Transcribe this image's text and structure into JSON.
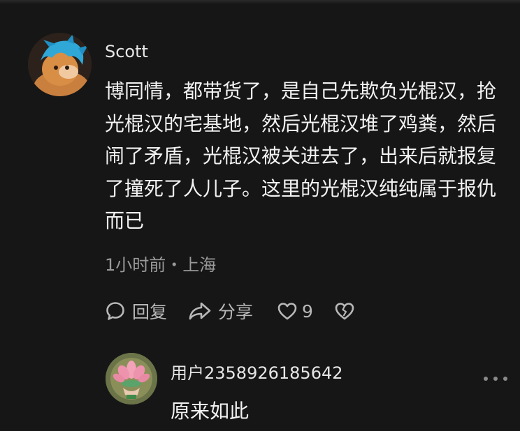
{
  "comments": [
    {
      "username": "Scott",
      "text": "博同情，都带货了，是自己先欺负光棍汉，抢光棍汉的宅基地，然后光棍汉堆了鸡粪，然后闹了矛盾，光棍汉被关进去了，出来后就报复了撞死了人儿子。这里的光棍汉纯纯属于报仇而已",
      "meta": "1小时前・上海",
      "actions": {
        "reply_label": "回复",
        "share_label": "分享",
        "like_count": "9"
      }
    },
    {
      "username": "用户2358926185642",
      "text": "原来如此"
    }
  ],
  "icons": {
    "reply": "comment-bubble-icon",
    "share": "share-arrow-icon",
    "like": "heart-icon",
    "dislike": "broken-heart-icon",
    "more": "more-dots-icon"
  },
  "colors": {
    "background": "#161616",
    "text": "#f2f2f2",
    "meta": "#9a9a9a",
    "icon": "#b8b8b8"
  }
}
